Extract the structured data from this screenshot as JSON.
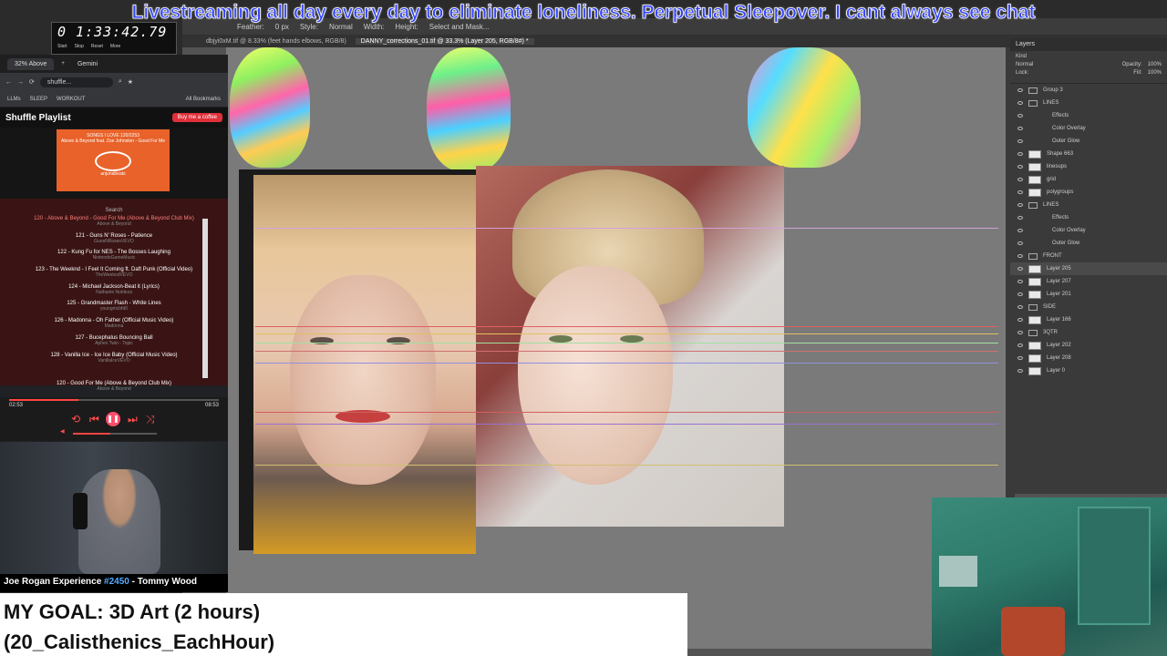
{
  "banner": {
    "text": "Livestreaming all day every day to eliminate loneliness. Perpetual Sleepover. I cant always see chat"
  },
  "timer": {
    "value": "0 1:33:42.79",
    "buttons": [
      "Start",
      "Stop",
      "Reset",
      "More"
    ]
  },
  "photoshop": {
    "menu_items": [
      "Feather:",
      "0 px",
      "Style:",
      "Normal",
      "Width:",
      "Height:",
      "Select and Mask..."
    ],
    "tabs": [
      "dbjyi0xM.tif @ 8.33% (feet hands elbows, RGB/8)",
      "DANNY_corrections_01.tif @ 33.3% (Layer 205, RGB/8#) *"
    ],
    "active_tab_index": 1,
    "layers_panel": {
      "title": "Layers",
      "kind": "Kind",
      "blend_mode": "Normal",
      "opacity_label": "Opacity:",
      "opacity": "100%",
      "lock_label": "Lock:",
      "fill_label": "Fill:",
      "fill": "100%",
      "layers": [
        {
          "name": "Group 3",
          "type": "group"
        },
        {
          "name": "LINES",
          "type": "group"
        },
        {
          "name": "Effects",
          "type": "effect"
        },
        {
          "name": "Color Overlay",
          "type": "effect"
        },
        {
          "name": "Outer Glow",
          "type": "effect"
        },
        {
          "name": "Shape 663",
          "type": "layer"
        },
        {
          "name": "linesups",
          "type": "layer"
        },
        {
          "name": "grid",
          "type": "layer"
        },
        {
          "name": "polygroups",
          "type": "layer"
        },
        {
          "name": "LINES",
          "type": "group"
        },
        {
          "name": "Effects",
          "type": "effect"
        },
        {
          "name": "Color Overlay",
          "type": "effect"
        },
        {
          "name": "Outer Glow",
          "type": "effect"
        },
        {
          "name": "FRONT",
          "type": "group"
        },
        {
          "name": "Layer 205",
          "type": "layer",
          "selected": true
        },
        {
          "name": "Layer 207",
          "type": "layer"
        },
        {
          "name": "Layer 201",
          "type": "layer"
        },
        {
          "name": "SIDE",
          "type": "group"
        },
        {
          "name": "Layer 166",
          "type": "layer"
        },
        {
          "name": "3QTR",
          "type": "group"
        },
        {
          "name": "Layer 202",
          "type": "layer"
        },
        {
          "name": "Layer 208",
          "type": "layer"
        },
        {
          "name": "Layer 0",
          "type": "layer"
        }
      ]
    }
  },
  "browser": {
    "tabs": [
      "32% Above",
      "Gemini"
    ],
    "address": "shuffle...",
    "bookmarks": [
      "LLMs",
      "SLEEP",
      "WORKOUT",
      "All Bookmarks"
    ]
  },
  "playlist": {
    "title": "Shuffle Playlist",
    "coffee_button": "Buy me a coffee",
    "album_header": "SONGS I LOVE  120/2253",
    "album_subtitle": "Above & Beyond feat. Zoe Johnston - Good For Me",
    "album_logo_text": "anjunabeats",
    "search_label": "Search",
    "songs": [
      {
        "title": "120 - Above & Beyond - Good For Me (Above & Beyond Club Mix)",
        "artist": "Above & Beyond",
        "current": true
      },
      {
        "title": "121 - Guns N' Roses - Patience",
        "artist": "GunsNRosesVEVO"
      },
      {
        "title": "122 - Kung Fu for NES - The Bosses Laughing",
        "artist": "NintendoGameMusic"
      },
      {
        "title": "123 - The Weeknd - I Feel It Coming ft. Daft Punk (Official Video)",
        "artist": "TheWeekndVEVO"
      },
      {
        "title": "124 - Michael Jackson-Beat it (Lyrics)",
        "artist": "Nathanie Nobleza"
      },
      {
        "title": "125 - Grandmaster Flash - White Lines",
        "artist": "youngmcbfd0"
      },
      {
        "title": "126 - Madonna - Oh Father (Official Music Video)",
        "artist": "Madonna"
      },
      {
        "title": "127 - Bucephalus Bouncing Ball",
        "artist": "Aphex Twin - Topic"
      },
      {
        "title": "128 - Vanilla Ice - Ice Ice Baby (Official Music Video)",
        "artist": "VanillaIceVEVO"
      }
    ],
    "now_playing": {
      "title": "120 - Good For Me (Above & Beyond Club Mix)",
      "artist": "Above & Beyond"
    },
    "time_current": "02:53",
    "time_total": "08:53",
    "progress": 0.33,
    "volume": 0.45
  },
  "webcam": {
    "caption_prefix": "Joe Rogan Experience ",
    "caption_episode": "#2450",
    "caption_suffix": " - Tommy Wood"
  },
  "goal": {
    "line1": "MY GOAL: 3D Art (2 hours)",
    "line2": "(20_Calisthenics_EachHour)"
  },
  "colors": {
    "banner_text": "#3344ff",
    "accent_red": "#ff4d4d",
    "ps_canvas_bg": "#7a7a7a"
  }
}
